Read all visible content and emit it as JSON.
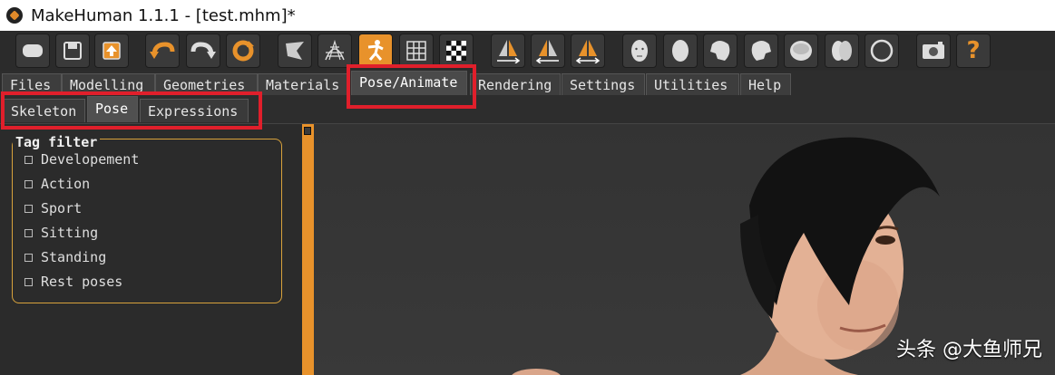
{
  "window": {
    "title": "MakeHuman 1.1.1 - [test.mhm]*"
  },
  "toolbar": {
    "icons": [
      "undo-draft-icon",
      "save-icon",
      "export-icon",
      "undo-icon",
      "redo-icon",
      "reset-icon",
      "smooth-icon",
      "wireframe-icon",
      "pose-icon",
      "grid-icon",
      "checker-icon",
      "symmetry-right-icon",
      "symmetry-left-icon",
      "symmetry-icon",
      "face-front-icon",
      "face-side-icon",
      "head-left-icon",
      "head-right-icon",
      "head-top-icon",
      "head-back-icon",
      "head-round-icon",
      "camera-icon",
      "help-icon"
    ],
    "help_label": "?"
  },
  "main_tabs": [
    {
      "label": "Files",
      "active": false
    },
    {
      "label": "Modelling",
      "active": false
    },
    {
      "label": "Geometries",
      "active": false
    },
    {
      "label": "Materials",
      "active": false
    },
    {
      "label": "Pose/Animate",
      "active": true
    },
    {
      "label": "Rendering",
      "active": false
    },
    {
      "label": "Settings",
      "active": false
    },
    {
      "label": "Utilities",
      "active": false
    },
    {
      "label": "Help",
      "active": false
    }
  ],
  "sub_tabs": [
    {
      "label": "Skeleton",
      "active": false
    },
    {
      "label": "Pose",
      "active": true
    },
    {
      "label": "Expressions",
      "active": false
    }
  ],
  "tag_filter": {
    "title": "Tag filter",
    "items": [
      {
        "label": "Developement",
        "checked": false
      },
      {
        "label": "Action",
        "checked": false
      },
      {
        "label": "Sport",
        "checked": false
      },
      {
        "label": "Sitting",
        "checked": false
      },
      {
        "label": "Standing",
        "checked": false
      },
      {
        "label": "Rest poses",
        "checked": false
      }
    ]
  },
  "watermark": "头条 @大鱼师兄",
  "colors": {
    "accent": "#e8922b",
    "annotation": "#e01f2b",
    "panel_bg": "#2b2b2b"
  }
}
